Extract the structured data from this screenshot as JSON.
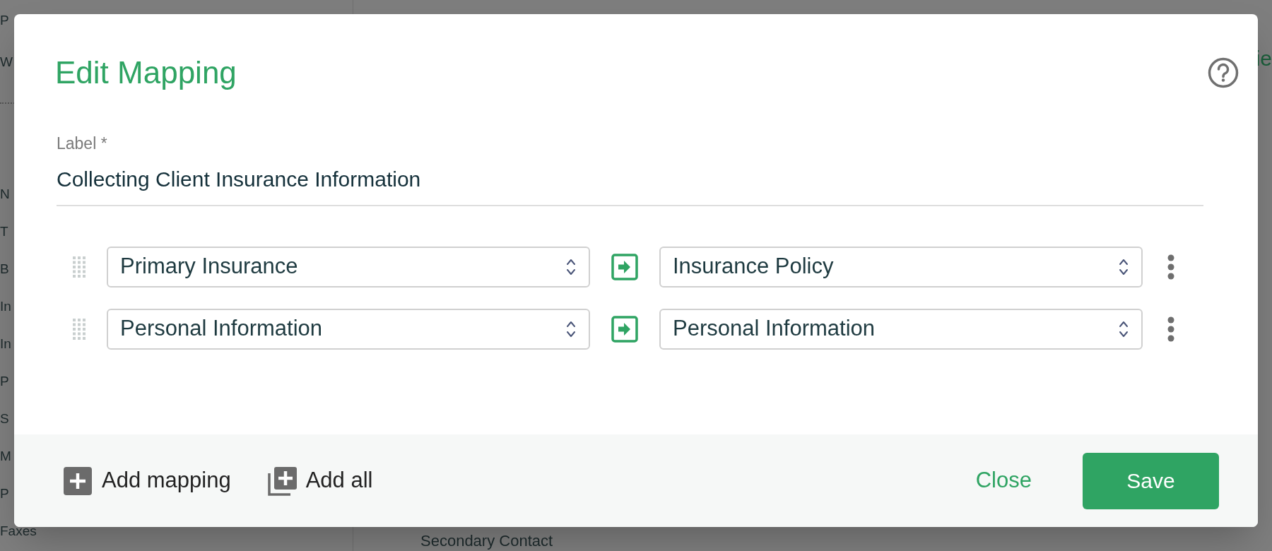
{
  "background": {
    "sidebar_top": [
      "P",
      "W"
    ],
    "sidebar_items": [
      "N",
      "T",
      "B",
      "In",
      "In",
      "P",
      "S",
      "M",
      "P",
      "Faxes"
    ],
    "header_fragment": "ie",
    "section_title": "Secondary Contact"
  },
  "dialog": {
    "title": "Edit Mapping",
    "label_field": {
      "label": "Label *",
      "value": "Collecting Client Insurance Information"
    },
    "mappings": [
      {
        "source": "Primary Insurance",
        "target": "Insurance Policy"
      },
      {
        "source": "Personal Information",
        "target": "Personal Information"
      }
    ],
    "footer": {
      "add_mapping": "Add mapping",
      "add_all": "Add all",
      "close": "Close",
      "save": "Save"
    }
  }
}
